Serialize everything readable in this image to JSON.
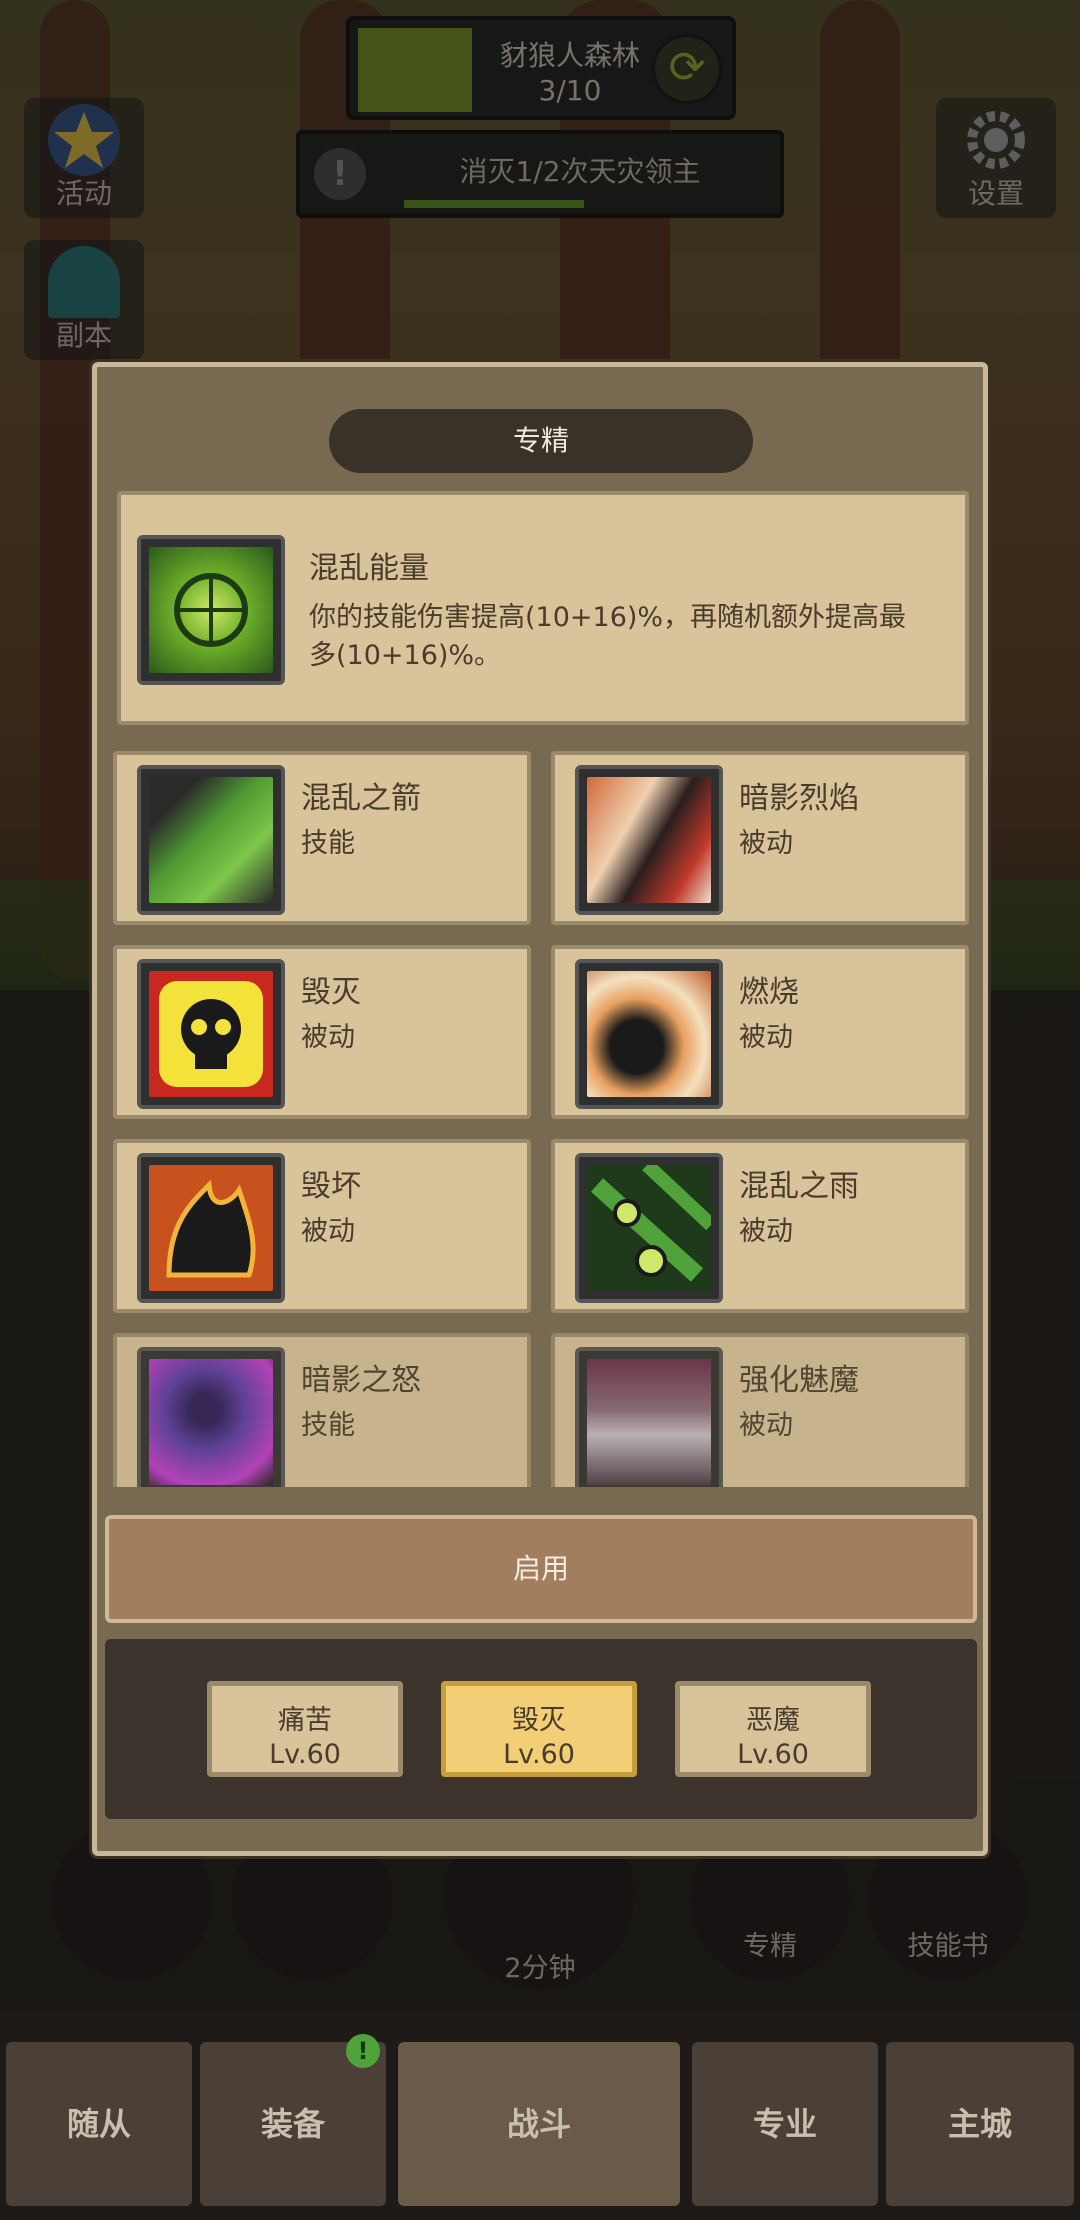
{
  "hud": {
    "stage_name": "豺狼人森林",
    "stage_count": "3/10",
    "quest_text": "消灭1/2次天灾领主",
    "left_buttons": [
      "活动",
      "副本"
    ],
    "settings_label": "设置"
  },
  "modal": {
    "title": "专精",
    "current": {
      "name": "混乱能量",
      "desc": "你的技能伤害提高(10+16)%，再随机额外提高最多(10+16)%。"
    },
    "skills": [
      {
        "name": "混乱之箭",
        "kind": "技能"
      },
      {
        "name": "暗影烈焰",
        "kind": "被动"
      },
      {
        "name": "毁灭",
        "kind": "被动"
      },
      {
        "name": "燃烧",
        "kind": "被动"
      },
      {
        "name": "毁坏",
        "kind": "被动"
      },
      {
        "name": "混乱之雨",
        "kind": "被动"
      },
      {
        "name": "暗影之怒",
        "kind": "技能"
      },
      {
        "name": "强化魅魔",
        "kind": "被动"
      }
    ],
    "enable_label": "启用",
    "specs": [
      {
        "name": "痛苦",
        "level": "Lv.60"
      },
      {
        "name": "毁灭",
        "level": "Lv.60"
      },
      {
        "name": "恶魔",
        "level": "Lv.60"
      }
    ]
  },
  "bottom": {
    "timer": "2分钟",
    "spec_label": "专精",
    "skillbook_label": "技能书",
    "nav": [
      "随从",
      "装备",
      "战斗",
      "专业",
      "主城"
    ],
    "badge": "!"
  }
}
